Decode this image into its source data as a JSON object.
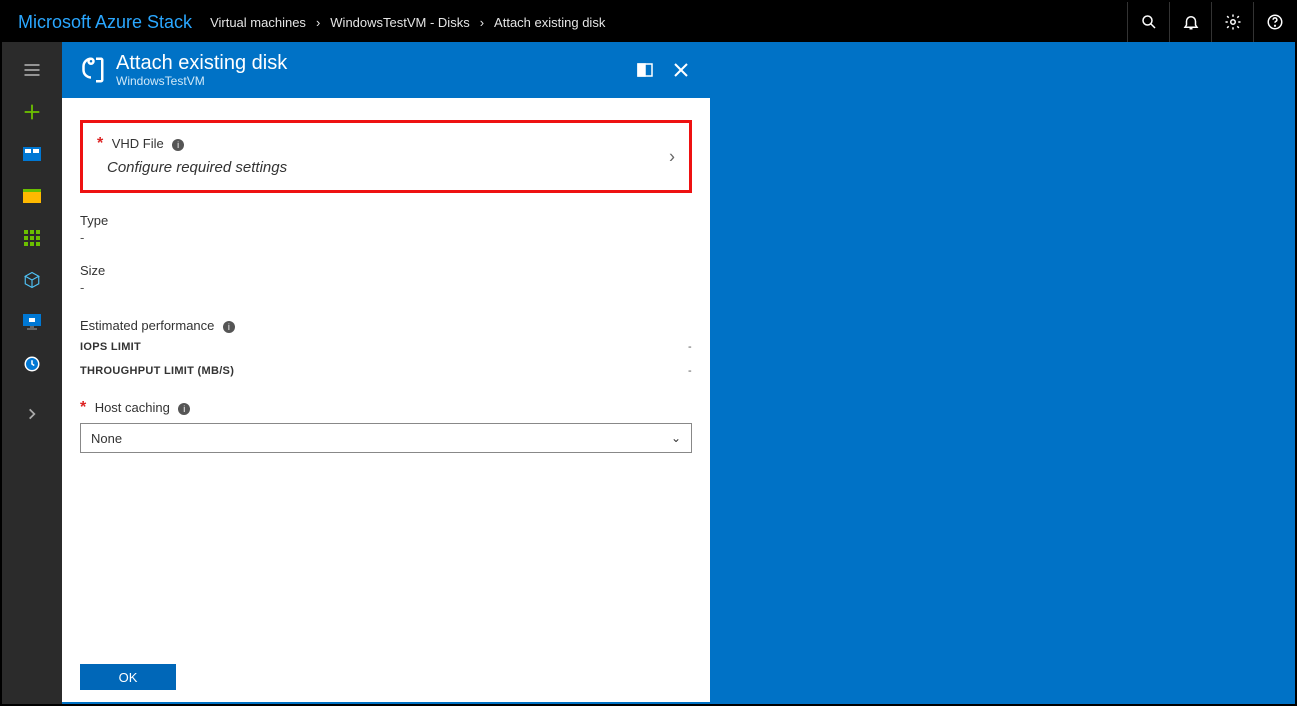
{
  "brand": "Microsoft Azure Stack",
  "breadcrumbs": [
    "Virtual machines",
    "WindowsTestVM - Disks",
    "Attach existing disk"
  ],
  "blade": {
    "title": "Attach existing disk",
    "subtitle": "WindowsTestVM"
  },
  "form": {
    "vhd": {
      "label": "VHD File",
      "prompt": "Configure required settings"
    },
    "type": {
      "label": "Type",
      "value": "-"
    },
    "size": {
      "label": "Size",
      "value": "-"
    },
    "performance": {
      "label": "Estimated performance",
      "iops": {
        "label": "IOPS LIMIT",
        "value": "-"
      },
      "throughput": {
        "label": "THROUGHPUT LIMIT (MB/S)",
        "value": "-"
      }
    },
    "hostCaching": {
      "label": "Host caching",
      "value": "None"
    },
    "okLabel": "OK"
  }
}
